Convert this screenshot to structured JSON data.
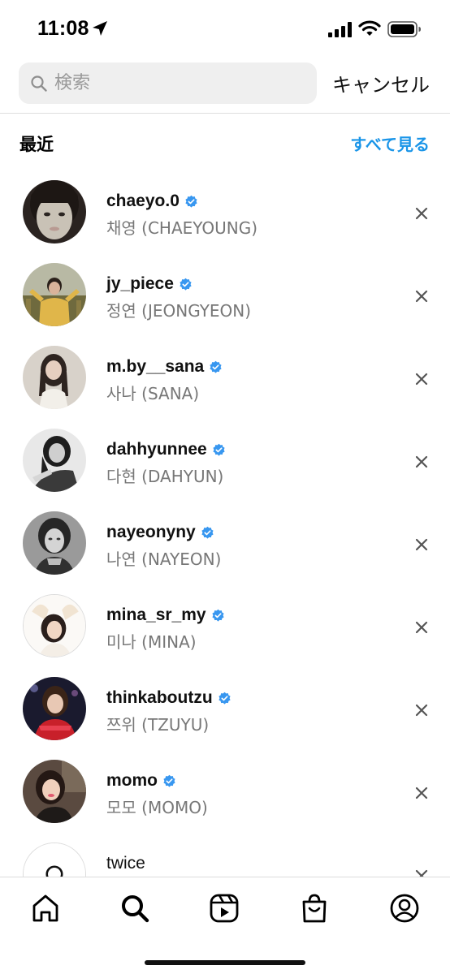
{
  "status_bar": {
    "time": "11:08",
    "icons": [
      "location-arrow-icon",
      "cellular-signal-icon",
      "wifi-icon",
      "battery-icon"
    ]
  },
  "search": {
    "placeholder": "検索",
    "value": "",
    "cancel_label": "キャンセル"
  },
  "recent": {
    "title": "最近",
    "see_all_label": "すべて見る",
    "items": [
      {
        "username": "chaeyo.0",
        "full_name": "채영 (CHAEYOUNG)",
        "verified": true
      },
      {
        "username": "jy_piece",
        "full_name": "정연 (JEONGYEON)",
        "verified": true
      },
      {
        "username": "m.by__sana",
        "full_name": "사나 (SANA)",
        "verified": true
      },
      {
        "username": "dahhyunnee",
        "full_name": "다현 (DAHYUN)",
        "verified": true
      },
      {
        "username": "nayeonyny",
        "full_name": "나연 (NAYEON)",
        "verified": true
      },
      {
        "username": "mina_sr_my",
        "full_name": "미나 (MINA)",
        "verified": true
      },
      {
        "username": "thinkaboutzu",
        "full_name": "쯔위 (TZUYU)",
        "verified": true
      },
      {
        "username": "momo",
        "full_name": "모모 (MOMO)",
        "verified": true
      },
      {
        "username": "twice",
        "full_name": "",
        "verified": false
      }
    ]
  },
  "tab_bar": {
    "tabs": [
      "home-icon",
      "search-icon",
      "reels-icon",
      "shop-icon",
      "profile-icon"
    ],
    "active": "search-icon"
  },
  "colors": {
    "accent": "#1a95e8",
    "verified": "#3897f0",
    "secondary_text": "#777777",
    "search_field": "#efefef"
  }
}
